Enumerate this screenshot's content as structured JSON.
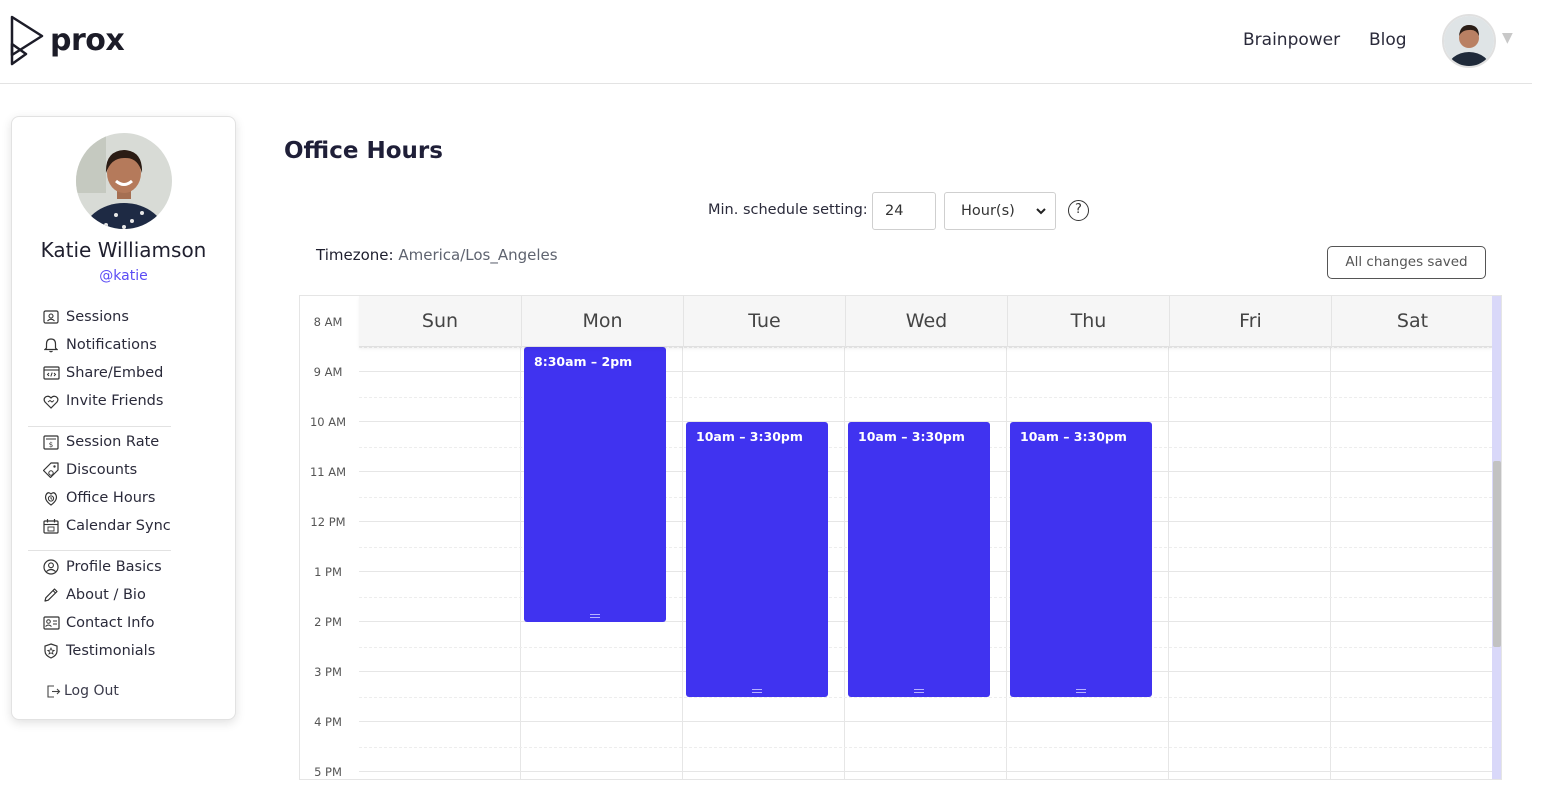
{
  "brand": {
    "name": "prox"
  },
  "topnav": {
    "brainpower": "Brainpower",
    "blog": "Blog"
  },
  "profile": {
    "name": "Katie Williamson",
    "handle": "@katie"
  },
  "menu": {
    "group1": [
      {
        "label": "Sessions",
        "icon": "sessions-icon"
      },
      {
        "label": "Notifications",
        "icon": "bell-icon"
      },
      {
        "label": "Share/Embed",
        "icon": "embed-icon"
      },
      {
        "label": "Invite Friends",
        "icon": "heart-icon"
      }
    ],
    "group2": [
      {
        "label": "Session Rate",
        "icon": "rate-icon"
      },
      {
        "label": "Discounts",
        "icon": "tag-icon"
      },
      {
        "label": "Office Hours",
        "icon": "office-hours-icon"
      },
      {
        "label": "Calendar Sync",
        "icon": "calendar-icon"
      }
    ],
    "group3": [
      {
        "label": "Profile Basics",
        "icon": "profile-icon"
      },
      {
        "label": "About / Bio",
        "icon": "pencil-icon"
      },
      {
        "label": "Contact Info",
        "icon": "contact-card-icon"
      },
      {
        "label": "Testimonials",
        "icon": "badge-icon"
      }
    ],
    "logout": "Log Out"
  },
  "page": {
    "title": "Office Hours",
    "min_schedule_label": "Min. schedule setting:",
    "min_schedule_value": "24",
    "min_schedule_unit": "Hour(s)",
    "help": "?",
    "timezone_label": "Timezone:",
    "timezone_value": "America/Los_Angeles",
    "save_status": "All changes saved"
  },
  "calendar": {
    "days": [
      "Sun",
      "Mon",
      "Tue",
      "Wed",
      "Thu",
      "Fri",
      "Sat"
    ],
    "hours": [
      "8 AM",
      "9 AM",
      "10 AM",
      "11 AM",
      "12 PM",
      "1 PM",
      "2 PM",
      "3 PM",
      "4 PM",
      "5 PM"
    ],
    "events": [
      {
        "day": "Mon",
        "label": "8:30am – 2pm",
        "start": 8.5,
        "end": 14
      },
      {
        "day": "Tue",
        "label": "10am – 3:30pm",
        "start": 10,
        "end": 15.5
      },
      {
        "day": "Wed",
        "label": "10am – 3:30pm",
        "start": 10,
        "end": 15.5
      },
      {
        "day": "Thu",
        "label": "10am – 3:30pm",
        "start": 10,
        "end": 15.5
      }
    ]
  },
  "colors": {
    "accent": "#4033f0",
    "handle": "#5b4cf5"
  }
}
